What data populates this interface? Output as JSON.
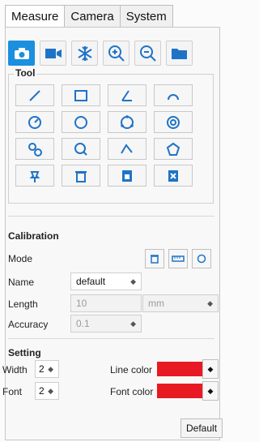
{
  "tabs": [
    {
      "label": "Measure",
      "active": true
    },
    {
      "label": "Camera",
      "active": false
    },
    {
      "label": "System",
      "active": false
    }
  ],
  "quick_actions": [
    {
      "icon": "camera-icon",
      "type": "capture"
    },
    {
      "icon": "video-camera-icon",
      "type": "record"
    },
    {
      "icon": "snowflake-icon",
      "type": "freeze"
    },
    {
      "icon": "zoom-in-icon",
      "type": "zoom-in"
    },
    {
      "icon": "zoom-out-icon",
      "type": "zoom-out"
    },
    {
      "icon": "folder-icon",
      "type": "open"
    }
  ],
  "tool": {
    "title": "Tool",
    "buttons": [
      "line-icon",
      "rectangle-icon",
      "angle-icon",
      "arc-icon",
      "circle-radius-icon",
      "circle-points-icon",
      "three-point-circle-icon",
      "concentric-circles-icon",
      "circle-distance-icon",
      "circle-search-icon",
      "polyline-icon",
      "polygon-icon",
      "pin-icon",
      "trash-icon",
      "calibration-file-icon",
      "excel-export-icon"
    ]
  },
  "calibration": {
    "title": "Calibration",
    "mode_label": "Mode",
    "name_label": "Name",
    "name_value": "default",
    "length_label": "Length",
    "length_value": "10",
    "unit_value": "mm",
    "accuracy_label": "Accuracy",
    "accuracy_value": "0.1"
  },
  "setting": {
    "title": "Setting",
    "width_label": "Width",
    "width_value": "2",
    "font_label": "Font",
    "font_value": "2",
    "line_color_label": "Line color",
    "font_color_label": "Font color",
    "line_color": "#e81923",
    "font_color": "#e81923"
  },
  "footer": {
    "default_label": "Default"
  },
  "colors": {
    "accent": "#1b8fe0",
    "icon": "#1f73c7",
    "warning": "#e81923"
  }
}
